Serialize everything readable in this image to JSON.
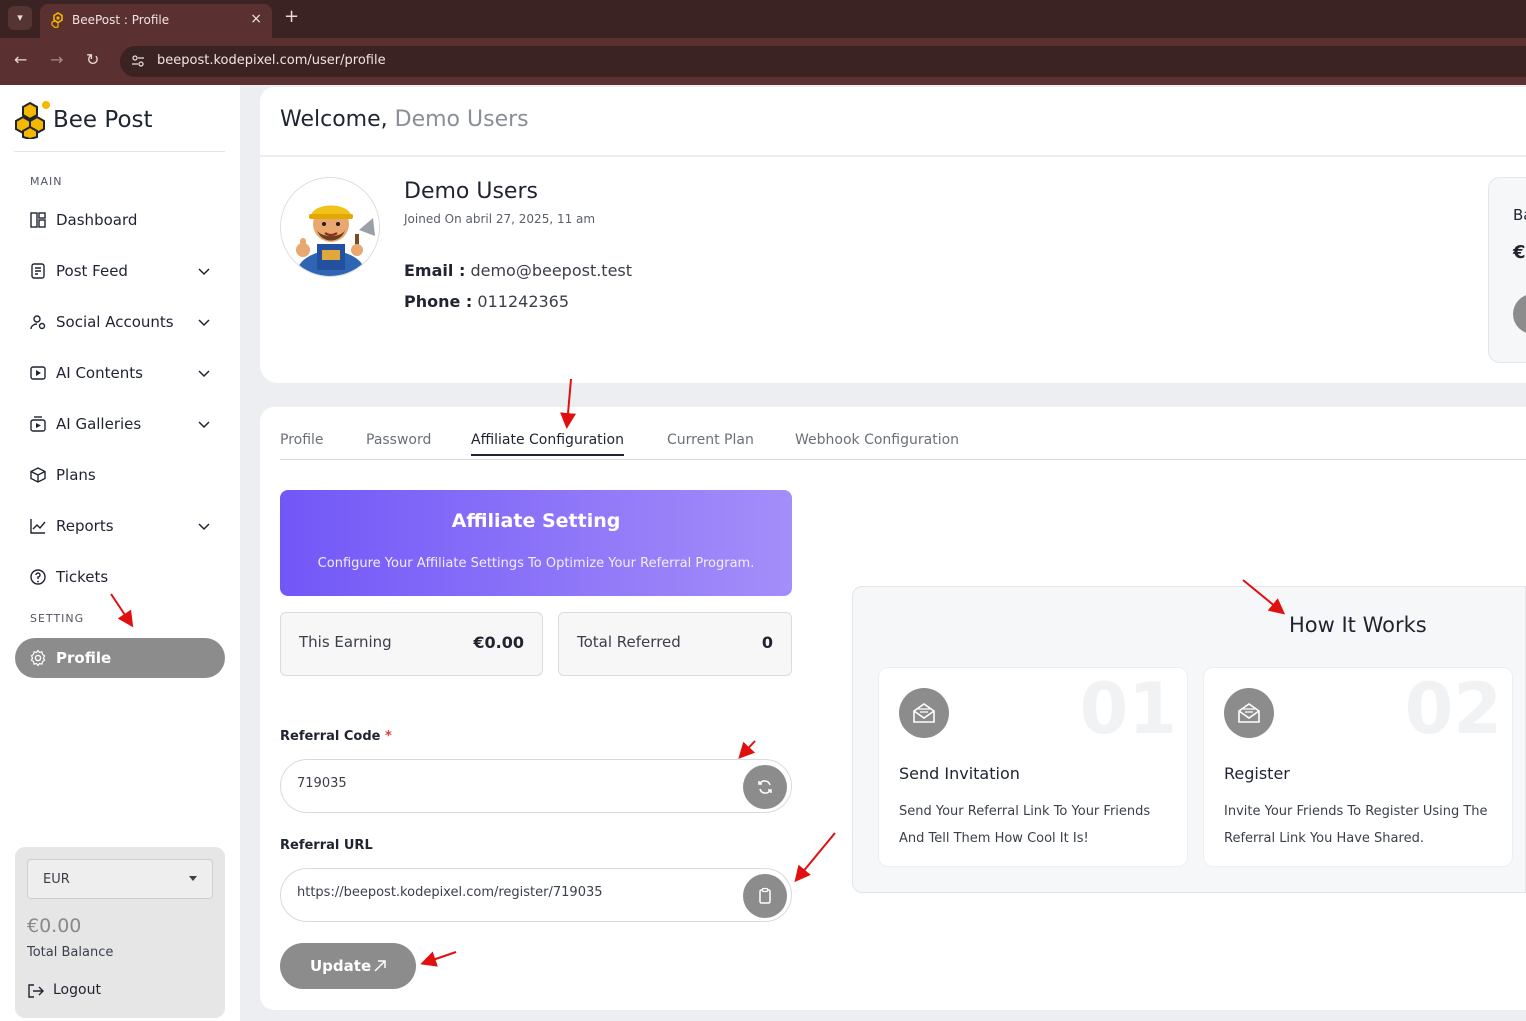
{
  "browser": {
    "tab_title": "BeePost : Profile",
    "tab_close": "×",
    "new_tab": "+",
    "url": "beepost.kodepixel.com/user/profile"
  },
  "sidebar": {
    "brand": "Bee Post",
    "main_label": "MAIN",
    "setting_label": "SETTING",
    "items": [
      {
        "label": "Dashboard",
        "icon": "dashboard-icon"
      },
      {
        "label": "Post Feed",
        "icon": "post-feed-icon"
      },
      {
        "label": "Social Accounts",
        "icon": "social-accounts-icon"
      },
      {
        "label": "AI Contents",
        "icon": "ai-contents-icon"
      },
      {
        "label": "AI Galleries",
        "icon": "ai-galleries-icon"
      },
      {
        "label": "Plans",
        "icon": "plans-icon"
      },
      {
        "label": "Reports",
        "icon": "reports-icon"
      },
      {
        "label": "Tickets",
        "icon": "tickets-icon"
      }
    ],
    "profile_label": "Profile",
    "currency": "EUR",
    "balance": "€0.00",
    "balance_label": "Total Balance",
    "logout": "Logout"
  },
  "welcome": {
    "prefix": "Welcome,",
    "name": "Demo Users"
  },
  "profile": {
    "name": "Demo Users",
    "joined": "Joined On abril 27, 2025, 11 am",
    "email_key": "Email :",
    "email": "demo@beepost.test",
    "phone_key": "Phone :",
    "phone": "011242365",
    "side_label": "Ba",
    "side_value": "€"
  },
  "tabs": [
    "Profile",
    "Password",
    "Affiliate Configuration",
    "Current Plan",
    "Webhook Configuration"
  ],
  "affiliate": {
    "title": "Affiliate Setting",
    "subtitle": "Configure Your Affiliate Settings To Optimize Your Referral Program.",
    "earning_label": "This Earning",
    "earning_value": "€0.00",
    "referred_label": "Total Referred",
    "referred_value": "0",
    "code_label": "Referral Code",
    "code_required": "*",
    "code_value": "719035",
    "url_label": "Referral URL",
    "url_value": "https://beepost.kodepixel.com/register/719035",
    "update_label": "Update"
  },
  "how": {
    "title": "How It Works",
    "steps": [
      {
        "num": "01",
        "title": "Send Invitation",
        "desc": "Send Your Referral Link To Your Friends And Tell Them How Cool It Is!"
      },
      {
        "num": "02",
        "title": "Register",
        "desc": "Invite Your Friends To Register Using The Referral Link You Have Shared."
      }
    ]
  },
  "colors": {
    "accent_gradient_start": "#7257f7",
    "accent_gradient_end": "#a48ef9",
    "active_gray": "#8c8c8c",
    "annotation_red": "#e01010"
  }
}
